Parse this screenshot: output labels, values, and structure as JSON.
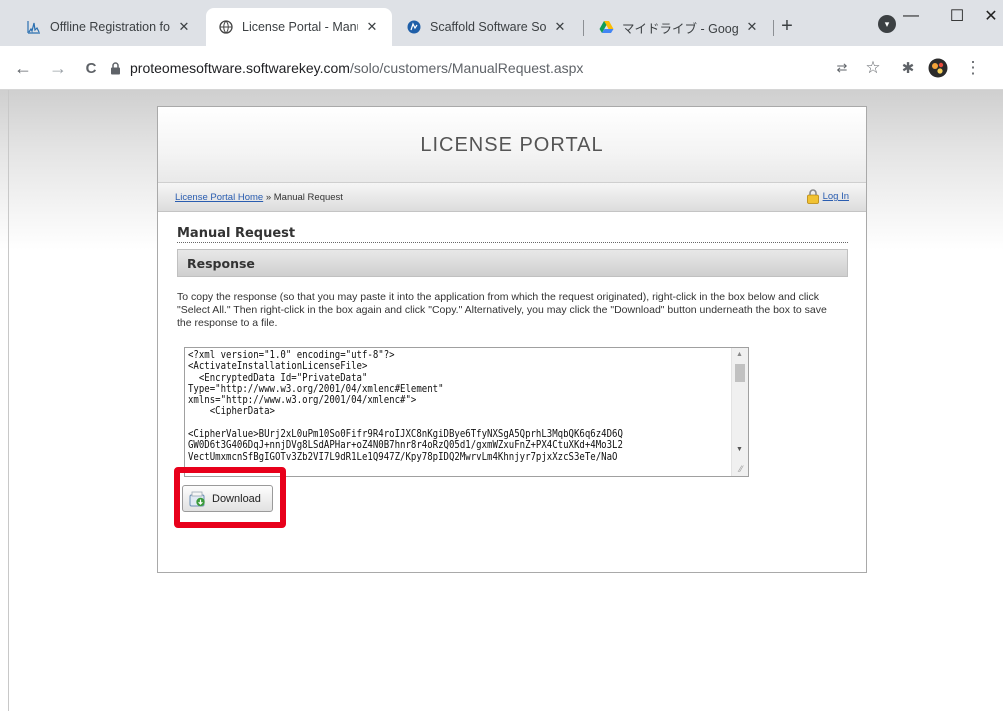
{
  "browser": {
    "tabs": [
      {
        "title": "Offline Registration for S",
        "icon": "sgraph-icon",
        "active": false
      },
      {
        "title": "License Portal - Manual |",
        "icon": "globe-icon",
        "active": true
      },
      {
        "title": "Scaffold Software Solutio",
        "icon": "scaffold-icon",
        "active": false
      },
      {
        "title": "マイドライブ - Google ドライ",
        "icon": "google-drive-icon",
        "active": false
      }
    ],
    "tab_close_glyph": "✕",
    "new_tab_glyph": "+",
    "url_domain": "proteomesoftware.softwarekey.com",
    "url_path": "/solo/customers/ManualRequest.aspx",
    "window_controls": {
      "minimize": "—",
      "maximize": "☐",
      "close": "✕"
    },
    "nav": {
      "back": "←",
      "forward": "→",
      "reload": "C"
    },
    "toolbar_icons": {
      "translate": "⇄",
      "bookmark": "☆",
      "extensions": "✱",
      "menu": "⋮"
    }
  },
  "portal": {
    "title": "LICENSE PORTAL",
    "breadcrumb_home": "License Portal Home",
    "breadcrumb_sep": " » ",
    "breadcrumb_current": "Manual Request",
    "login_label": "Log In"
  },
  "manual_request": {
    "heading": "Manual Request",
    "response_label": "Response",
    "instructions": "To copy the response (so that you may paste it into the application from which the request originated), right-click in the box below and click \"Select All.\" Then right-click in the box again and click \"Copy.\" Alternatively, you may click the \"Download\" button underneath the box to save the response to a file.",
    "response_xml": "<?xml version=\"1.0\" encoding=\"utf-8\"?>\n<ActivateInstallationLicenseFile>\n  <EncryptedData Id=\"PrivateData\"\nType=\"http://www.w3.org/2001/04/xmlenc#Element\"\nxmlns=\"http://www.w3.org/2001/04/xmlenc#\">\n    <CipherData>\n\n<CipherValue>BUrj2xL0uPm10So0Fifr9R4roIJXC8nKgiDBye6TfyNXSgA5QprhL3MqbQK6q6z4D6Q\nGW0D6t3G406DqJ+nnjDVg8LSdAPHar+oZ4N0B7hnr8r4oRzQ05d1/gxmWZxuFnZ+PX4CtuXKd+4Mo3L2\nVectUmxmcnSfBgIGOTv3Zb2VI7L9dR1Le1Q947Z/Kpy78pIDQ2MwrvLm4Khnjyr7pjxXzcS3eTe/NaO",
    "download_label": "Download"
  }
}
